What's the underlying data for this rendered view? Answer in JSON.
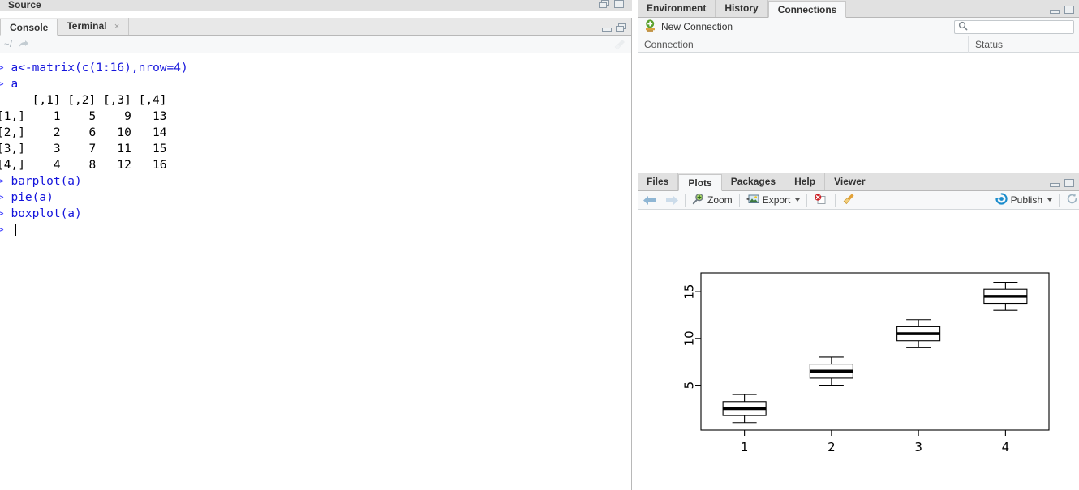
{
  "source_panel": {
    "title": "Source",
    "window_controls": [
      "restore-icon",
      "maximize-icon"
    ]
  },
  "console_panel": {
    "tabs": [
      {
        "label": "Console",
        "active": true,
        "closable": false
      },
      {
        "label": "Terminal",
        "active": false,
        "closable": true,
        "close_glyph": "×"
      }
    ],
    "path": "~/",
    "share_icon": "share-arrow-icon",
    "clear_icon": "broom-icon",
    "window_controls": [
      "minimize-icon",
      "restore-icon"
    ],
    "lines": [
      {
        "type": "input",
        "prompt": "> ",
        "text": "a<-matrix(c(1:16),nrow=4)"
      },
      {
        "type": "input",
        "prompt": "> ",
        "text": "a"
      },
      {
        "type": "output",
        "text": "     [,1] [,2] [,3] [,4]"
      },
      {
        "type": "output",
        "text": "[1,]    1    5    9   13"
      },
      {
        "type": "output",
        "text": "[2,]    2    6   10   14"
      },
      {
        "type": "output",
        "text": "[3,]    3    7   11   15"
      },
      {
        "type": "output",
        "text": "[4,]    4    8   12   16"
      },
      {
        "type": "input",
        "prompt": "> ",
        "text": "barplot(a)"
      },
      {
        "type": "input",
        "prompt": "> ",
        "text": "pie(a)"
      },
      {
        "type": "input",
        "prompt": "> ",
        "text": "boxplot(a)"
      },
      {
        "type": "caret",
        "prompt": "> ",
        "text": ""
      }
    ]
  },
  "env_panel": {
    "tabs": [
      {
        "label": "Environment",
        "active": false
      },
      {
        "label": "History",
        "active": false
      },
      {
        "label": "Connections",
        "active": true
      }
    ],
    "window_controls": [
      "minimize-icon",
      "maximize-icon"
    ],
    "new_connection": {
      "label": "New Connection",
      "icon": "new-connection-icon"
    },
    "search": {
      "placeholder": "",
      "value": "",
      "icon": "search-icon"
    },
    "columns": [
      "Connection",
      "Status",
      ""
    ],
    "rows": []
  },
  "plot_panel": {
    "tabs": [
      {
        "label": "Files",
        "active": false
      },
      {
        "label": "Plots",
        "active": true
      },
      {
        "label": "Packages",
        "active": false
      },
      {
        "label": "Help",
        "active": false
      },
      {
        "label": "Viewer",
        "active": false
      }
    ],
    "window_controls": [
      "minimize-icon",
      "maximize-icon"
    ],
    "toolbar": {
      "back": {
        "icon": "back-arrow-icon",
        "enabled": true
      },
      "forward": {
        "icon": "forward-arrow-icon",
        "enabled": false
      },
      "zoom": {
        "label": "Zoom",
        "icon": "magnifier-plus-icon"
      },
      "export": {
        "label": "Export",
        "icon": "export-image-icon",
        "has_dropdown": true
      },
      "remove": {
        "icon": "remove-plot-icon"
      },
      "clear_all": {
        "icon": "broom-icon"
      },
      "publish": {
        "label": "Publish",
        "icon": "publish-icon",
        "has_dropdown": true
      },
      "refresh": {
        "icon": "refresh-icon"
      }
    }
  },
  "colors": {
    "chrome": "#e1e1e1",
    "panel_bg": "#f7f8f9",
    "border": "#b8b8b8",
    "console_cmd": "#1414dc",
    "prompt": "#4a4aff",
    "publish_blue": "#1a8ccc",
    "new_conn_green": "#5aa02c",
    "axis_text": "#1a1a1a"
  },
  "chart_data": {
    "type": "boxplot",
    "title": "",
    "xlabel": "",
    "ylabel": "",
    "categories": [
      "1",
      "2",
      "3",
      "4"
    ],
    "xticks": [
      "1",
      "2",
      "3",
      "4"
    ],
    "yticks": [
      5,
      10,
      15
    ],
    "ylim": [
      0.2,
      17.0
    ],
    "grid": false,
    "legend": false,
    "frame": true,
    "series": [
      {
        "name": "1",
        "min": 1,
        "q1": 1.75,
        "median": 2.5,
        "q3": 3.25,
        "max": 4
      },
      {
        "name": "2",
        "min": 5,
        "q1": 5.75,
        "median": 6.5,
        "q3": 7.25,
        "max": 8
      },
      {
        "name": "3",
        "min": 9,
        "q1": 9.75,
        "median": 10.5,
        "q3": 11.25,
        "max": 12
      },
      {
        "name": "4",
        "min": 13,
        "q1": 13.75,
        "median": 14.5,
        "q3": 15.25,
        "max": 16
      }
    ]
  }
}
